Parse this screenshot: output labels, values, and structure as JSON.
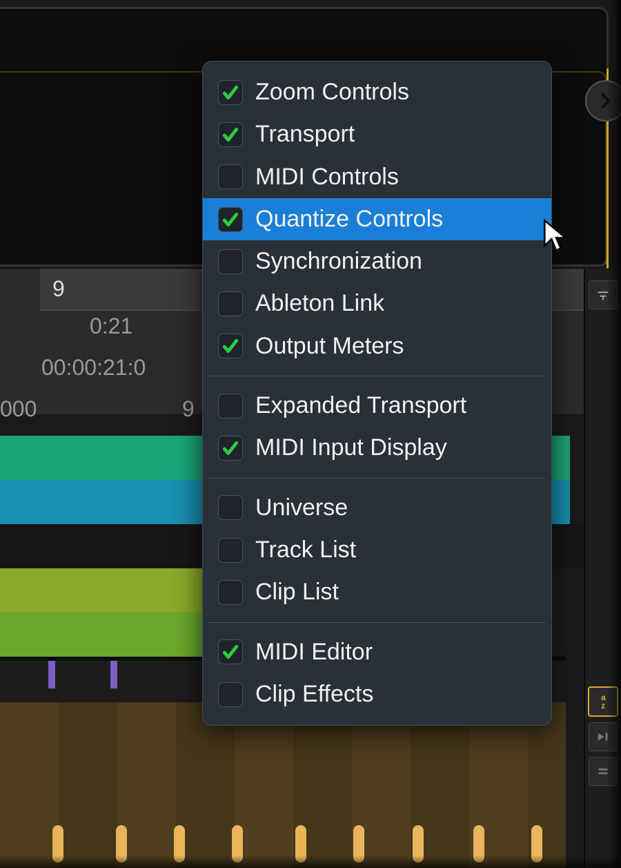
{
  "timeline": {
    "bar_number": "9",
    "time_mmss": "0:21",
    "time_smpte": "00:00:21:0",
    "samples_label": "000",
    "samples_right": "9"
  },
  "menu": {
    "groups": [
      [
        {
          "label": "Zoom Controls",
          "checked": true,
          "highlight": false
        },
        {
          "label": "Transport",
          "checked": true,
          "highlight": false
        },
        {
          "label": "MIDI Controls",
          "checked": false,
          "highlight": false
        },
        {
          "label": "Quantize Controls",
          "checked": true,
          "highlight": true
        },
        {
          "label": "Synchronization",
          "checked": false,
          "highlight": false
        },
        {
          "label": "Ableton Link",
          "checked": false,
          "highlight": false
        },
        {
          "label": "Output Meters",
          "checked": true,
          "highlight": false
        }
      ],
      [
        {
          "label": "Expanded Transport",
          "checked": false,
          "highlight": false
        },
        {
          "label": "MIDI Input Display",
          "checked": true,
          "highlight": false
        }
      ],
      [
        {
          "label": "Universe",
          "checked": false,
          "highlight": false
        },
        {
          "label": "Track List",
          "checked": false,
          "highlight": false
        },
        {
          "label": "Clip List",
          "checked": false,
          "highlight": false
        }
      ],
      [
        {
          "label": "MIDI Editor",
          "checked": true,
          "highlight": false
        },
        {
          "label": "Clip Effects",
          "checked": false,
          "highlight": false
        }
      ]
    ]
  }
}
